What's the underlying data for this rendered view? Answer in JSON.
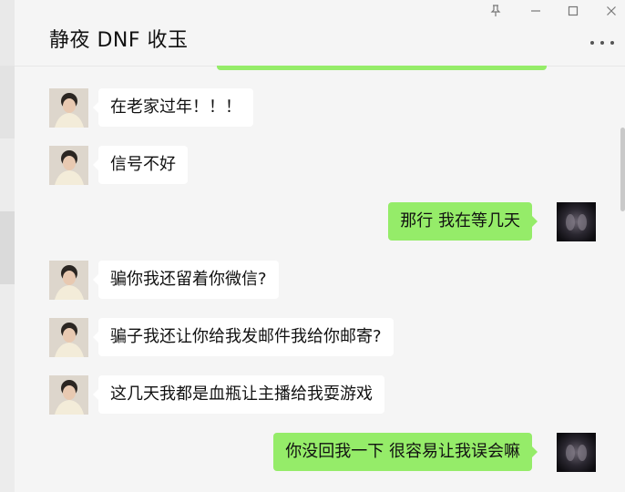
{
  "chat": {
    "title": "静夜 DNF 收玉"
  },
  "window_controls": {
    "pin_icon": "pin-icon",
    "minimize_icon": "minimize-icon",
    "maximize_icon": "maximize-icon",
    "close_icon": "close-icon",
    "more_icon": "more-icon"
  },
  "messages": [
    {
      "direction": "in",
      "text": "在老家过年！！！"
    },
    {
      "direction": "in",
      "text": "信号不好"
    },
    {
      "direction": "out",
      "text": "那行 我在等几天"
    },
    {
      "direction": "in",
      "text": "骗你我还留着你微信?"
    },
    {
      "direction": "in",
      "text": "骗子我还让你给我发邮件我给你邮寄?"
    },
    {
      "direction": "in",
      "text": "这几天我都是血瓶让主播给我耍游戏"
    },
    {
      "direction": "out",
      "text": "你没回我一下 很容易让我误会嘛"
    }
  ],
  "colors": {
    "outgoing_bubble": "#95ec69",
    "incoming_bubble": "#ffffff",
    "background": "#f5f5f5"
  }
}
